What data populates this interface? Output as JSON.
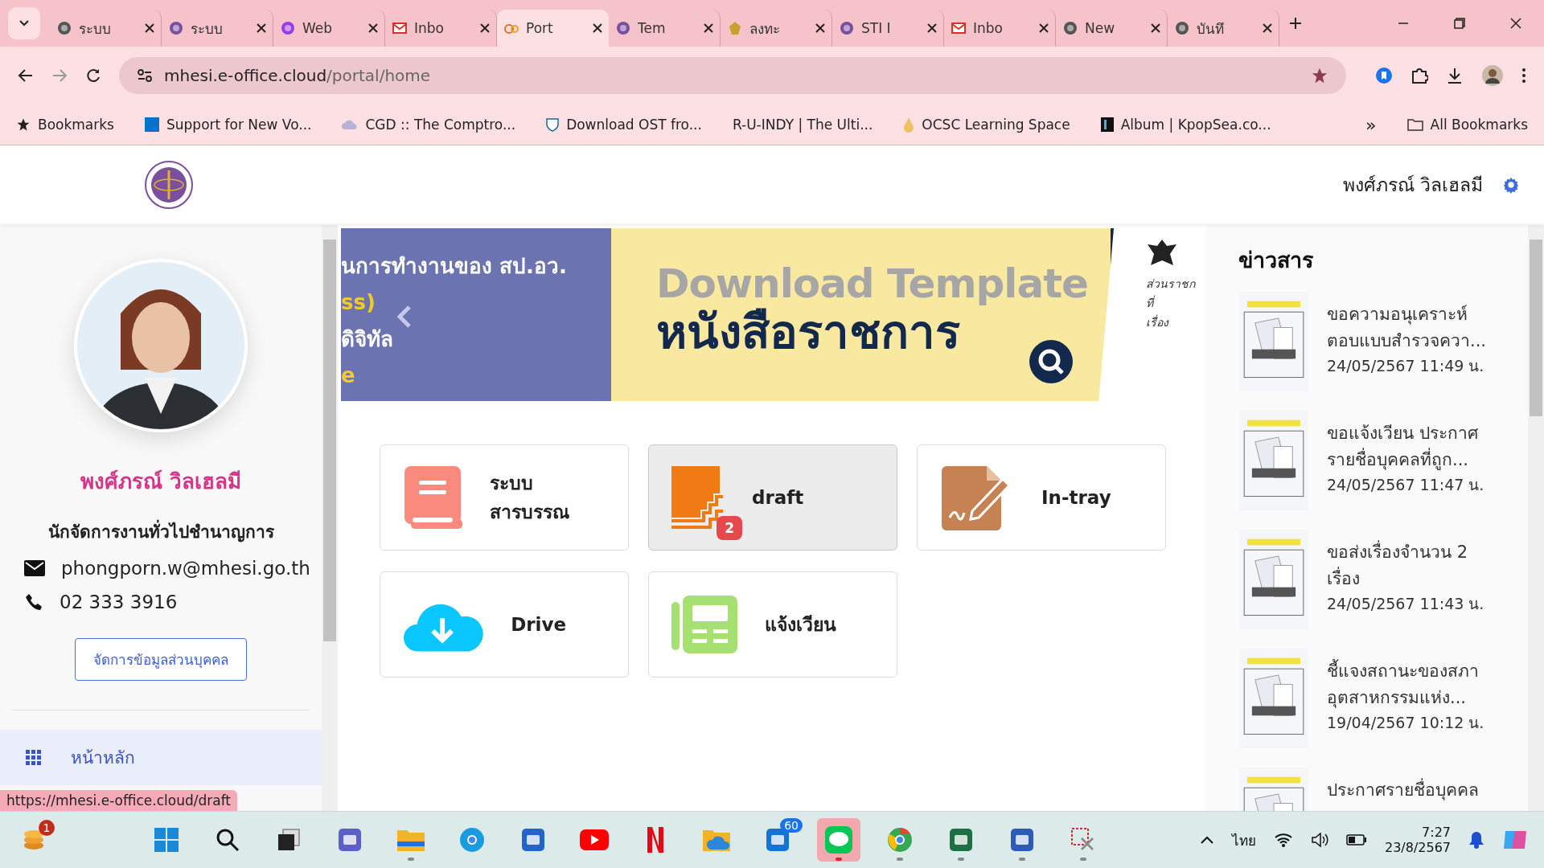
{
  "browser": {
    "tabs": [
      {
        "title": "ระบบ",
        "selected": false
      },
      {
        "title": "ระบบ",
        "selected": false
      },
      {
        "title": "Web",
        "selected": false
      },
      {
        "title": "Inbo",
        "selected": false
      },
      {
        "title": "Port",
        "selected": true
      },
      {
        "title": "Tem",
        "selected": false
      },
      {
        "title": "ลงทะ",
        "selected": false
      },
      {
        "title": "STI I",
        "selected": false
      },
      {
        "title": "Inbo",
        "selected": false
      },
      {
        "title": "New",
        "selected": false
      },
      {
        "title": "บันทึ",
        "selected": false
      }
    ],
    "address": {
      "host": "mhesi.e-office.cloud",
      "path": "/portal/home"
    },
    "bookmarks": [
      {
        "label": "Bookmarks"
      },
      {
        "label": "Support for New Vo..."
      },
      {
        "label": "CGD :: The Comptro..."
      },
      {
        "label": "Download OST fro..."
      },
      {
        "label": "R-U-INDY | The Ulti..."
      },
      {
        "label": "OCSC Learning Space"
      },
      {
        "label": "Album | KpopSea.co..."
      }
    ],
    "more": "»",
    "all_bookmarks": "All Bookmarks"
  },
  "header": {
    "user_name": "พงศ์ภรณ์ วิลเฮลมี"
  },
  "profile": {
    "name": "พงศ์ภรณ์ วิลเฮลมี",
    "position": "นักจัดการงานทั่วไปชำนาญการ",
    "email": "phongporn.w@mhesi.go.th",
    "phone": "02 333 3916",
    "button": "จัดการข้อมูลส่วนบุคคล"
  },
  "nav": [
    {
      "label": "หน้าหลัก",
      "selected": true
    }
  ],
  "banner": {
    "left_lines": [
      "นการทำงานของ สป.อว.",
      "ss)",
      "ดิจิทัล",
      "e"
    ],
    "title": "Download Template",
    "subtitle": "หนังสือราชการ",
    "doc_lines": [
      "ส่วนราชก",
      "ที่",
      "เรื่อง"
    ]
  },
  "apps": [
    {
      "label": "ระบบ สารบรรณ",
      "kind": "book",
      "highlighted": false
    },
    {
      "label": "draft",
      "kind": "draft",
      "badge": "2",
      "highlighted": true
    },
    {
      "label": "In-tray",
      "kind": "intray",
      "highlighted": false
    },
    {
      "label": "Drive",
      "kind": "drive",
      "highlighted": false
    },
    {
      "label": "แจ้งเวียน",
      "kind": "notice",
      "highlighted": false
    }
  ],
  "news": {
    "heading": "ข่าวสาร",
    "items": [
      {
        "title": "ขอความอนุเคราะห์ ตอบแบบสำรวจควา...",
        "date": "24/05/2567 11:49 น."
      },
      {
        "title": "ขอแจ้งเวียน ประกาศ รายชื่อบุคคลที่ถูก...",
        "date": "24/05/2567 11:47 น."
      },
      {
        "title": "ขอส่งเรื่องจำนวน 2 เรื่อง",
        "date": "24/05/2567 11:43 น."
      },
      {
        "title": "ชี้แจงสถานะของสภา อุตสาหกรรมแห่ง...",
        "date": "19/04/2567 10:12 น."
      },
      {
        "title": "ประกาศรายชื่อบุคคล"
      }
    ]
  },
  "status_url": "https://mhesi.e-office.cloud/draft",
  "taskbar": {
    "widget_badge": "1",
    "apps": [
      {
        "kind": "start",
        "running": false
      },
      {
        "kind": "search",
        "running": false
      },
      {
        "kind": "taskview",
        "running": false
      },
      {
        "kind": "teams",
        "running": false
      },
      {
        "kind": "folder",
        "running": true
      },
      {
        "kind": "edge",
        "running": false
      },
      {
        "kind": "store",
        "running": false
      },
      {
        "kind": "youtube",
        "running": false
      },
      {
        "kind": "netflix",
        "running": false
      },
      {
        "kind": "onedrive",
        "running": false
      },
      {
        "kind": "outlook",
        "badge": "60",
        "running": false
      },
      {
        "kind": "line",
        "running": true,
        "selected": true
      },
      {
        "kind": "chrome",
        "running": true
      },
      {
        "kind": "excel",
        "running": true
      },
      {
        "kind": "word",
        "running": true
      },
      {
        "kind": "snip",
        "running": true
      }
    ],
    "language": "ไทย",
    "time": "7:27",
    "date": "23/8/2567"
  }
}
